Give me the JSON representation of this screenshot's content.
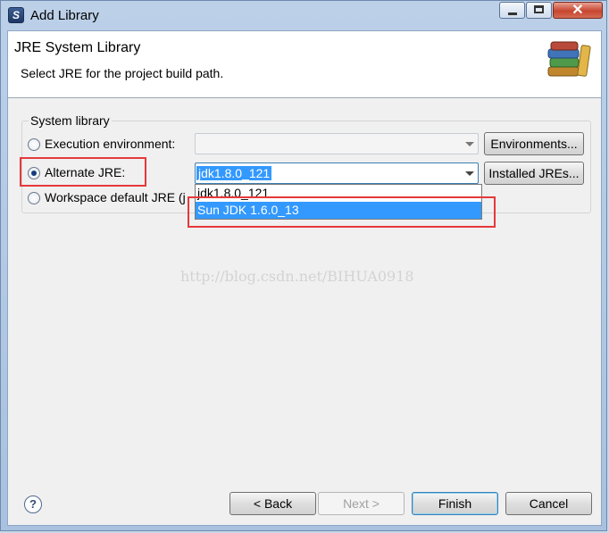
{
  "window": {
    "title": "Add Library",
    "controls": [
      "minimize",
      "maximize",
      "close"
    ]
  },
  "header": {
    "title": "JRE System Library",
    "description": "Select JRE for the project build path.",
    "icon": "library-books-icon"
  },
  "group": {
    "label": "System library",
    "options": [
      {
        "label": "Execution environment:",
        "selected": false,
        "value": "",
        "enabled": false,
        "button": "Environments..."
      },
      {
        "label": "Alternate JRE:",
        "selected": true,
        "value": "jdk1.8.0_121",
        "enabled": true,
        "button": "Installed JREs..."
      },
      {
        "label": "Workspace default JRE (j",
        "selected": false
      }
    ]
  },
  "dropdown": {
    "items": [
      "jdk1.8.0_121",
      "Sun JDK 1.6.0_13"
    ],
    "highlighted_index": 1
  },
  "watermark": "http://blog.csdn.net/BIHUA0918",
  "footer": {
    "help_glyph": "?",
    "back_label": "< Back",
    "next_label": "Next >",
    "finish_label": "Finish",
    "cancel_label": "Cancel"
  },
  "colors": {
    "accent": "#3399ff",
    "annotation": "#e5393a"
  }
}
